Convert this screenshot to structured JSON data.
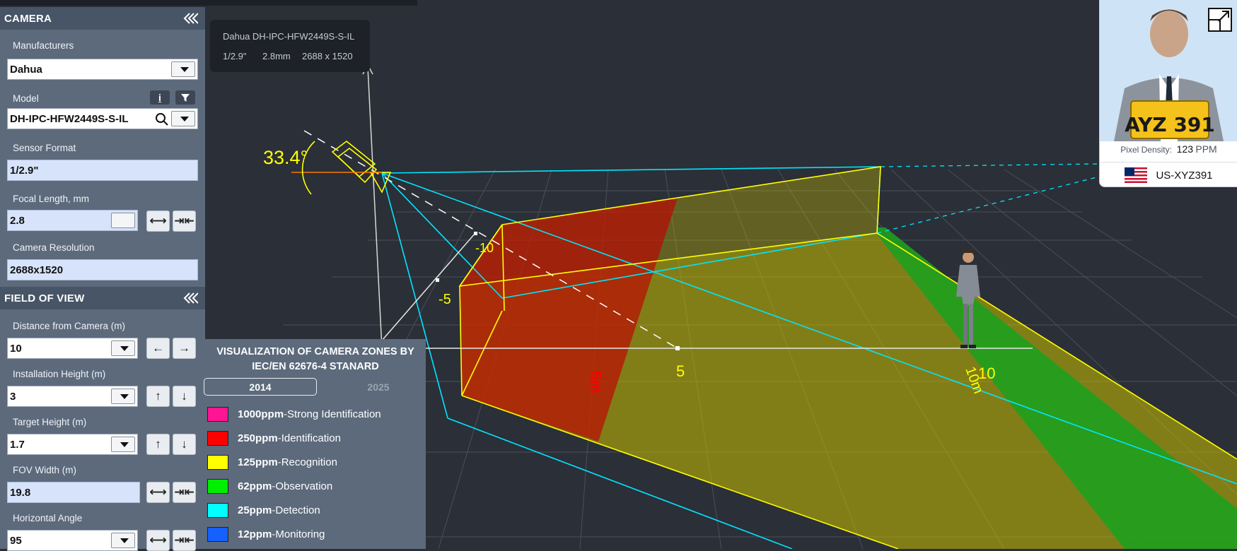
{
  "camera_panel": {
    "title": "CAMERA",
    "manufacturers_label": "Manufacturers",
    "manufacturer_value": "Dahua",
    "model_label": "Model",
    "info_btn": "i",
    "model_value": "DH-IPC-HFW2449S-S-IL",
    "sensor_label": "Sensor Format",
    "sensor_value": "1/2.9\"",
    "focal_label": "Focal Length, mm",
    "focal_value": "2.8",
    "resolution_label": "Camera Resolution",
    "resolution_value": "2688x1520"
  },
  "fov_panel": {
    "title": "FIELD OF VIEW",
    "distance_label": "Distance from Camera (m)",
    "distance_value": "10",
    "height_label": "Installation Height (m)",
    "height_value": "3",
    "target_label": "Target Height (m)",
    "target_value": "1.7",
    "width_label": "FOV Width (m)",
    "width_value": "19.8",
    "angle_label": "Horizontal Angle",
    "angle_value": "95"
  },
  "camera_info": {
    "name": "Dahua DH-IPC-HFW2449S-S-IL",
    "sensor": "1/2.9\"",
    "lens": "2.8mm",
    "resolution": "2688 x 1520"
  },
  "scene": {
    "tilt_angle": "33.4°",
    "tick_minus10": "-10",
    "tick_minus5": "-5",
    "tick_5": "5",
    "tick_10": "10",
    "marker_red": "5m",
    "marker_green": "10m"
  },
  "legend": {
    "title_line1": "VISUALIZATION OF CAMERA ZONES BY",
    "title_line2": "IEC/EN 62676-4 STANARD",
    "tab_2014": "2014",
    "tab_2025": "2025",
    "rows": [
      {
        "ppm": "1000ppm",
        "label": "Strong Identification",
        "color": "#ff1493"
      },
      {
        "ppm": "250ppm",
        "label": "Identification",
        "color": "#ff0000"
      },
      {
        "ppm": "125ppm",
        "label": "Recognition",
        "color": "#ffff00"
      },
      {
        "ppm": "62ppm",
        "label": "Observation",
        "color": "#00ee00"
      },
      {
        "ppm": "25ppm",
        "label": "Detection",
        "color": "#00ffff"
      },
      {
        "ppm": "12ppm",
        "label": "Monitoring",
        "color": "#1560ff"
      }
    ]
  },
  "preview": {
    "plate_text": "AYZ 391",
    "pixel_density_label": "Pixel Density:",
    "pixel_density_value": "123",
    "pixel_density_unit": "PPM",
    "plate_id": "US-XYZ391"
  },
  "colors": {
    "panel": "#5c6a7c",
    "header": "#485567",
    "background": "#2b2f37",
    "fov_edge_yellow": "#ffff00",
    "fov_edge_cyan": "#00e5ff"
  }
}
